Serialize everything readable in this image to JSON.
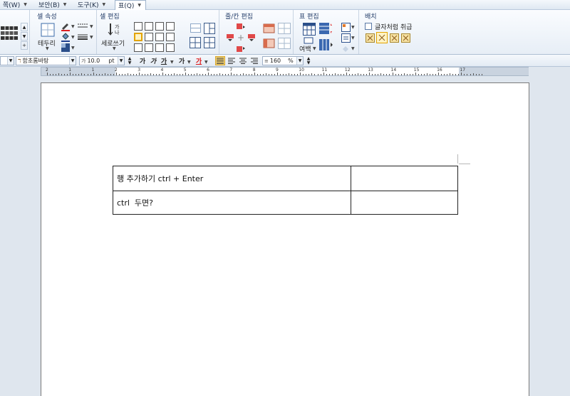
{
  "menu": {
    "items": [
      {
        "label": "쪽(W)"
      },
      {
        "label": "보안(B)"
      },
      {
        "label": "도구(K)"
      },
      {
        "label": "표(Q)"
      }
    ]
  },
  "ribbon": {
    "groups": {
      "cell_props": {
        "title": "셀 속성",
        "border_label": "테두리"
      },
      "cell_edit": {
        "title": "셀 편집",
        "vertical_text_label": "세로쓰기"
      },
      "row_col_edit": {
        "title": "줄/칸 편집"
      },
      "table_edit": {
        "title": "표 편집",
        "margin_label": "여백"
      },
      "layout": {
        "title": "배치",
        "treat_as_char_label": "글자처럼 취급"
      }
    }
  },
  "format_toolbar": {
    "font_name": "함초롬바탕",
    "font_size": "10.0",
    "font_size_unit": "pt",
    "bold_label": "가",
    "italic_label": "가",
    "underline_label": "가",
    "strike_label": "가",
    "color_label": "가",
    "line_spacing": "160",
    "line_spacing_unit": "%"
  },
  "ruler": {
    "numbers": [
      "2",
      "1",
      "1",
      "2",
      "3",
      "4",
      "5",
      "6",
      "7",
      "8",
      "9",
      "10",
      "11",
      "12",
      "13",
      "14",
      "15",
      "16",
      "17"
    ]
  },
  "document": {
    "table": {
      "rows": [
        [
          "행 추가하기 ctrl + Enter",
          ""
        ],
        [
          "ctrl  두면?",
          ""
        ]
      ]
    }
  },
  "colors": {
    "accent": "#27406b",
    "page_bg": "#dfe6ee"
  }
}
